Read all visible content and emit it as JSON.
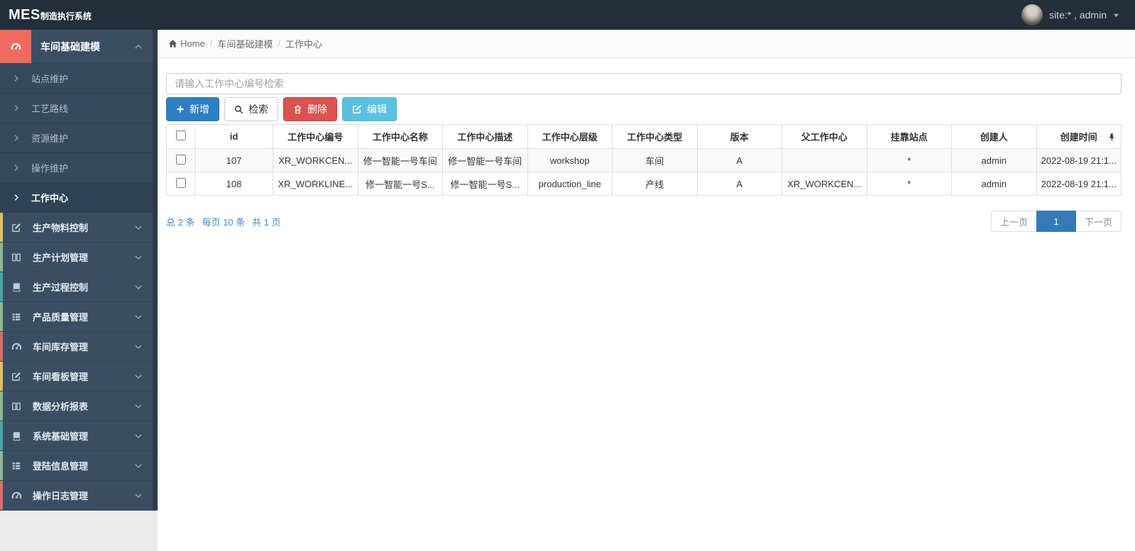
{
  "navbar": {
    "brand": "MES",
    "brand_suffix": "制造执行系统",
    "user_label": "site:* , admin"
  },
  "sidebar": {
    "active_group": {
      "label": "车间基础建模",
      "icon": "dashboard-icon",
      "accent": "#ef6b5e"
    },
    "submenu": [
      {
        "label": "站点维护",
        "active": false
      },
      {
        "label": "工艺路线",
        "active": false
      },
      {
        "label": "资源维护",
        "active": false
      },
      {
        "label": "操作维护",
        "active": false
      },
      {
        "label": "工作中心",
        "active": true
      }
    ],
    "groups": [
      {
        "label": "生产物料控制",
        "icon": "edit-icon",
        "accent": "#e3bd5d"
      },
      {
        "label": "生产计划管理",
        "icon": "columns-icon",
        "accent": "#8cb890"
      },
      {
        "label": "生产过程控制",
        "icon": "book-icon",
        "accent": "#4aa4a8"
      },
      {
        "label": "产品质量管理",
        "icon": "list-icon",
        "accent": "#8cb890"
      },
      {
        "label": "车间库存管理",
        "icon": "dashboard-icon",
        "accent": "#dd6e68"
      },
      {
        "label": "车间看板管理",
        "icon": "edit-icon",
        "accent": "#e3bd5d"
      },
      {
        "label": "数据分析报表",
        "icon": "columns-icon",
        "accent": "#8cb890"
      },
      {
        "label": "系统基础管理",
        "icon": "book-icon",
        "accent": "#4aa4a8"
      },
      {
        "label": "登陆信息管理",
        "icon": "list-icon",
        "accent": "#8cb890"
      },
      {
        "label": "操作日志管理",
        "icon": "dashboard-icon",
        "accent": "#dd6e68"
      }
    ]
  },
  "breadcrumb": {
    "items": [
      "Home",
      "车间基础建模",
      "工作中心"
    ]
  },
  "search": {
    "placeholder": "请输入工作中心编号检索",
    "value": ""
  },
  "toolbar": {
    "add_label": "新增",
    "search_label": "检索",
    "delete_label": "删除",
    "edit_label": "编辑"
  },
  "table": {
    "headers": [
      "id",
      "工作中心编号",
      "工作中心名称",
      "工作中心描述",
      "工作中心层级",
      "工作中心类型",
      "版本",
      "父工作中心",
      "挂靠站点",
      "创建人",
      "创建时间"
    ],
    "rows": [
      [
        "107",
        "XR_WORKCEN...",
        "修一智能一号车间",
        "修一智能一号车间",
        "workshop",
        "车间",
        "A",
        "",
        "*",
        "admin",
        "2022-08-19 21:1..."
      ],
      [
        "108",
        "XR_WORKLINE...",
        "修一智能一号S...",
        "修一智能一号S...",
        "production_line",
        "产线",
        "A",
        "XR_WORKCEN...",
        "*",
        "admin",
        "2022-08-19 21:1..."
      ]
    ]
  },
  "pagination": {
    "summary": [
      "总 2 条",
      "每页 10 条",
      "共 1 页"
    ],
    "prev_label": "上一页",
    "current_page": "1",
    "next_label": "下一页"
  },
  "colors": {
    "primary_button": "#2d7fc1",
    "danger_button": "#d9534f",
    "info_button": "#5bc0de",
    "active_menu_accent": "#ef6b5e",
    "pagination_active": "#337ab7",
    "link_blue": "#428bca"
  }
}
